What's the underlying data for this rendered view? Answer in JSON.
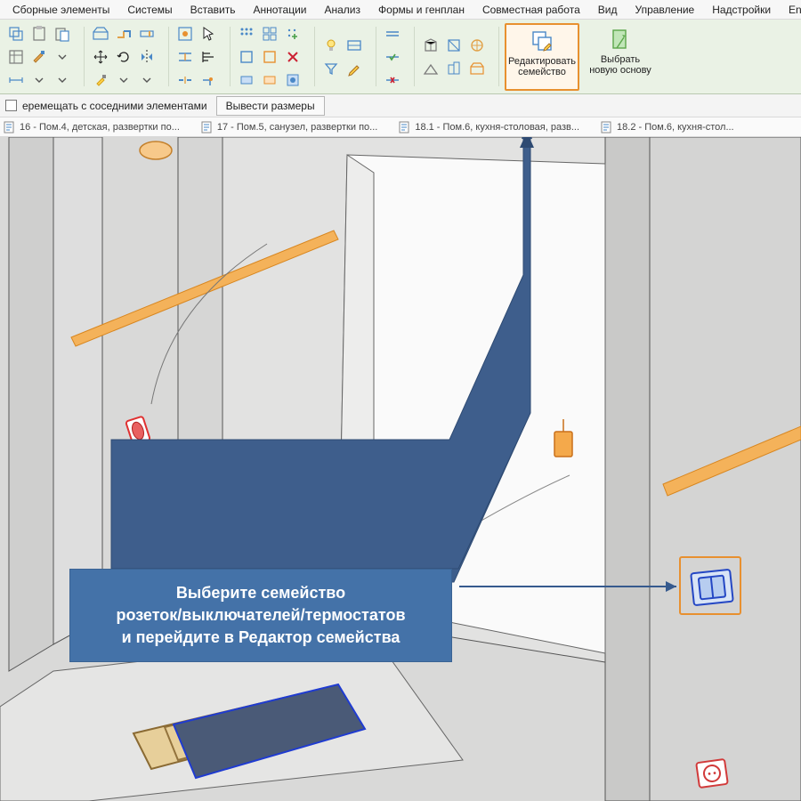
{
  "menu": {
    "items": [
      "Сборные элементы",
      "Системы",
      "Вставить",
      "Аннотации",
      "Анализ",
      "Формы и генплан",
      "Совместная работа",
      "Вид",
      "Управление",
      "Надстройки",
      "Ensc"
    ]
  },
  "ribbon": {
    "edit_family": {
      "l1": "Редактировать",
      "l2": "семейство"
    },
    "pick_host": {
      "l1": "Выбрать",
      "l2": "новую основу"
    }
  },
  "options": {
    "checkbox_label": "еремещать с соседними элементами",
    "dims_button": "Вывести размеры"
  },
  "tabs": [
    "16 - Пом.4, детская, развертки по...",
    "17 - Пом.5, санузел, развертки по...",
    "18.1 - Пом.6, кухня-столовая, разв...",
    "18.2 - Пом.6, кухня-стол..."
  ],
  "callout": {
    "line1": "Выберите семейство",
    "line2": "розеток/выключателей/термостатов",
    "line3": "и перейдите в Редактор семейства"
  },
  "colors": {
    "accent_orange": "#e8902f",
    "callout_blue": "#4472a8"
  }
}
